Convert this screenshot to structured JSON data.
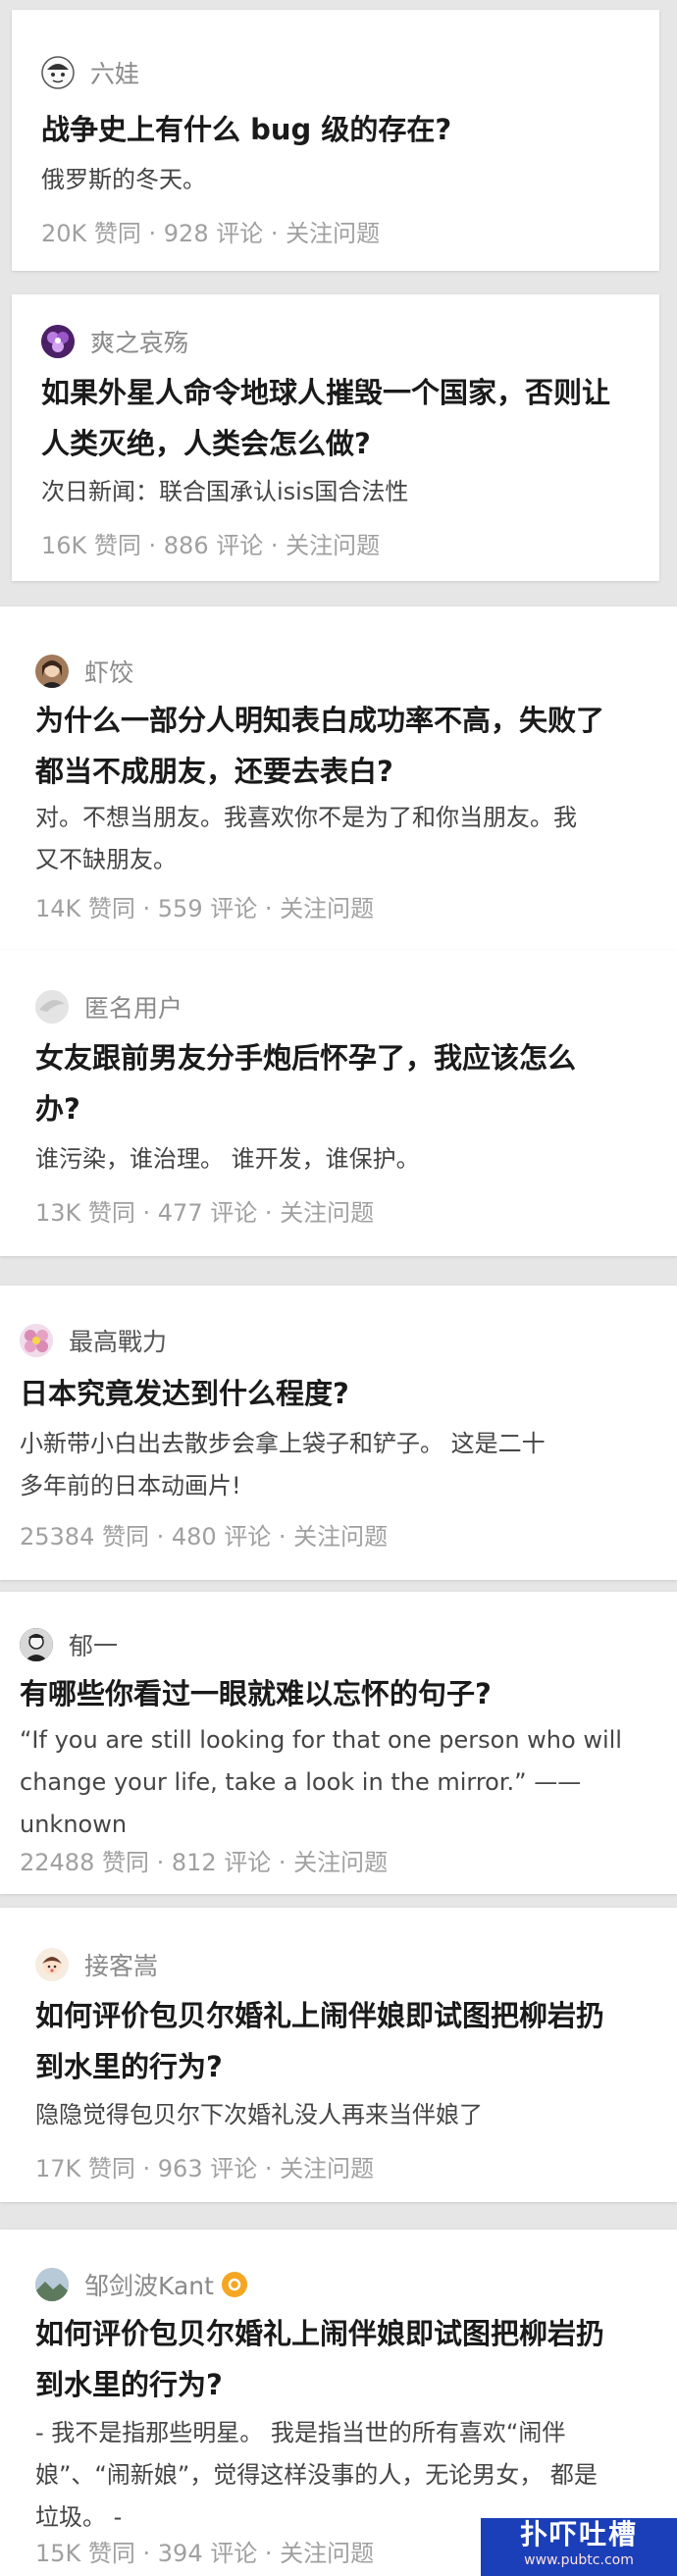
{
  "feed": [
    {
      "author": "六娃",
      "avatar_icon": "cartoon-face-icon",
      "question": "战争史上有什么 bug 级的存在?",
      "answer": "俄罗斯的冬天。",
      "meta": "20K 赞同 · 928 评论 · 关注问题"
    },
    {
      "author": "爽之哀殇",
      "avatar_icon": "purple-flower-icon",
      "question_lines": [
        "如果外星人命令地球人摧毁一个国家，否则让",
        "人类灭绝，人类会怎么做?"
      ],
      "answer": "次日新闻：联合国承认isis国合法性",
      "meta": "16K 赞同 · 886 评论 · 关注问题"
    },
    {
      "author": "虾饺",
      "avatar_icon": "woman-portrait-icon",
      "question_lines": [
        "为什么一部分人明知表白成功率不高，失败了",
        "都当不成朋友，还要去表白?"
      ],
      "answer_lines": [
        "对。不想当朋友。我喜欢你不是为了和你当朋友。我",
        "又不缺朋友。"
      ],
      "meta": "14K 赞同 · 559 评论 · 关注问题"
    },
    {
      "author": "匿名用户",
      "avatar_icon": "anonymous-user-icon",
      "question_lines": [
        "女友跟前男友分手炮后怀孕了，我应该怎么",
        "办?"
      ],
      "answer": "谁污染，谁治理。 谁开发，谁保护。",
      "meta": "13K 赞同 · 477 评论 · 关注问题"
    },
    {
      "author": "最高戰力",
      "avatar_icon": "flower-icon",
      "question": "日本究竟发达到什么程度?",
      "answer_lines": [
        "小新带小白出去散步会拿上袋子和铲子。 这是二十",
        "多年前的日本动画片!"
      ],
      "meta": "25384 赞同 · 480 评论 · 关注问题"
    },
    {
      "author": "郁一",
      "avatar_icon": "man-portrait-icon",
      "question": "有哪些你看过一眼就难以忘怀的句子?",
      "answer_lines": [
        "“If you are still looking for that one person who will",
        "change your life, take a look in the mirror.” ——",
        "unknown"
      ],
      "meta": "22488 赞同 · 812 评论 · 关注问题"
    },
    {
      "author": "接客嵩",
      "avatar_icon": "cartoon-girl-icon",
      "question_lines": [
        "如何评价包贝尔婚礼上闹伴娘即试图把柳岩扔",
        "到水里的行为?"
      ],
      "answer": "隐隐觉得包贝尔下次婚礼没人再来当伴娘了",
      "meta": "17K 赞同 · 963 评论 · 关注问题"
    },
    {
      "author": "邹剑波Kant",
      "avatar_icon": "landscape-avatar-icon",
      "verified_icon": "verified-badge-icon",
      "question_lines": [
        "如何评价包贝尔婚礼上闹伴娘即试图把柳岩扔",
        "到水里的行为?"
      ],
      "answer_lines": [
        "- 我不是指那些明星。 我是指当世的所有喜欢“闹伴",
        "娘”、“闹新娘”，觉得这样没事的人，无论男女， 都是",
        "垃圾。 -"
      ],
      "meta": "15K 赞同 · 394 评论 · 关注问题"
    }
  ],
  "watermark": {
    "title": "扑吓吐槽",
    "url": "www.pubtc.com"
  }
}
